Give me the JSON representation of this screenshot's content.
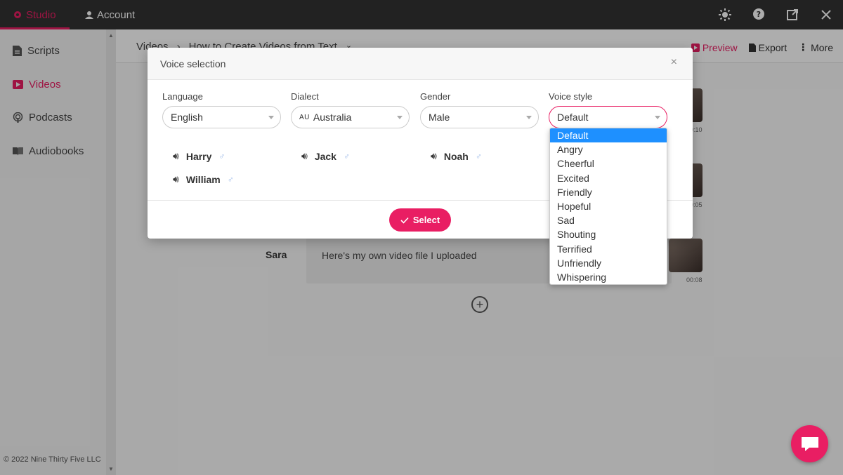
{
  "topbar": {
    "tabs": [
      {
        "label": "Studio",
        "icon": "gear-icon"
      },
      {
        "label": "Account",
        "icon": "user-icon"
      }
    ],
    "actions": [
      "sun-icon",
      "help-icon",
      "external-link-icon",
      "close-icon"
    ]
  },
  "sidebar": {
    "items": [
      {
        "label": "Scripts",
        "icon": "document-icon"
      },
      {
        "label": "Videos",
        "icon": "video-icon"
      },
      {
        "label": "Podcasts",
        "icon": "podcast-icon"
      },
      {
        "label": "Audiobooks",
        "icon": "book-icon"
      }
    ],
    "copyright": "© 2022 Nine Thirty Five LLC"
  },
  "main": {
    "breadcrumb": [
      "Videos",
      "›",
      "How to Create Videos from Text"
    ],
    "actions": {
      "preview": "Preview",
      "export": "Export",
      "more": "More"
    },
    "scene": {
      "actor": "Sara",
      "text": "Here's my own video file I uploaded"
    },
    "thumb_times": [
      "00:10",
      "00:05",
      "00:08"
    ]
  },
  "modal": {
    "title": "Voice selection",
    "fields": {
      "language": {
        "label": "Language",
        "value": "English"
      },
      "dialect": {
        "label": "Dialect",
        "flag": "AU",
        "value": "Australia"
      },
      "gender": {
        "label": "Gender",
        "value": "Male"
      },
      "voice_style": {
        "label": "Voice style",
        "value": "Default"
      }
    },
    "voices": [
      {
        "name": "Harry",
        "gender": "♂"
      },
      {
        "name": "Jack",
        "gender": "♂"
      },
      {
        "name": "Noah",
        "gender": "♂"
      },
      {
        "name": "William",
        "gender": "♂"
      }
    ],
    "select_label": "Select"
  },
  "dropdown": {
    "options": [
      "Default",
      "Angry",
      "Cheerful",
      "Excited",
      "Friendly",
      "Hopeful",
      "Sad",
      "Shouting",
      "Terrified",
      "Unfriendly",
      "Whispering"
    ],
    "selected": "Default"
  },
  "colors": {
    "accent": "#e91e63",
    "highlight": "#1e90ff",
    "topbar": "#333333"
  }
}
